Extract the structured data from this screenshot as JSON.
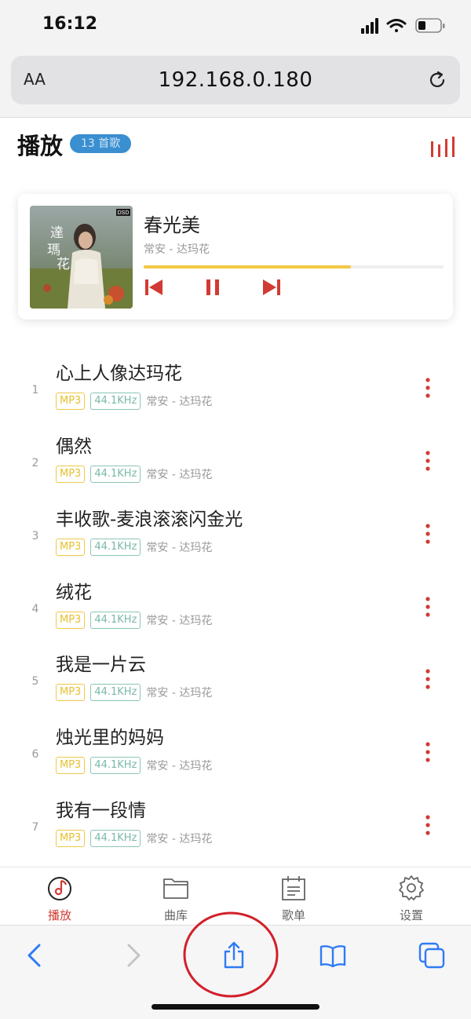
{
  "status_bar": {
    "time": "16:12"
  },
  "browser": {
    "text_size_label": "AA",
    "url": "192.168.0.180"
  },
  "header": {
    "title": "播放",
    "count_badge": "13 首歌"
  },
  "now_playing": {
    "title": "春光美",
    "artist": "常安 - 达玛花",
    "progress": 0.69,
    "cover_badge": "DSD"
  },
  "songs": [
    {
      "index": "1",
      "title": "心上人像达玛花",
      "format": "MP3",
      "sample_rate": "44.1KHz",
      "artist": "常安 - 达玛花"
    },
    {
      "index": "2",
      "title": "偶然",
      "format": "MP3",
      "sample_rate": "44.1KHz",
      "artist": "常安 - 达玛花"
    },
    {
      "index": "3",
      "title": "丰收歌-麦浪滚滚闪金光",
      "format": "MP3",
      "sample_rate": "44.1KHz",
      "artist": "常安 - 达玛花"
    },
    {
      "index": "4",
      "title": "绒花",
      "format": "MP3",
      "sample_rate": "44.1KHz",
      "artist": "常安 - 达玛花"
    },
    {
      "index": "5",
      "title": "我是一片云",
      "format": "MP3",
      "sample_rate": "44.1KHz",
      "artist": "常安 - 达玛花"
    },
    {
      "index": "6",
      "title": "烛光里的妈妈",
      "format": "MP3",
      "sample_rate": "44.1KHz",
      "artist": "常安 - 达玛花"
    },
    {
      "index": "7",
      "title": "我有一段情",
      "format": "MP3",
      "sample_rate": "44.1KHz",
      "artist": "常安 - 达玛花"
    }
  ],
  "app_nav": {
    "items": [
      {
        "label": "播放",
        "icon": "music-note-icon",
        "active": true
      },
      {
        "label": "曲库",
        "icon": "folder-icon",
        "active": false
      },
      {
        "label": "歌单",
        "icon": "playlist-icon",
        "active": false
      },
      {
        "label": "设置",
        "icon": "gear-icon",
        "active": false
      }
    ]
  },
  "toolbar": {
    "icons": [
      "back-icon",
      "forward-icon",
      "share-icon",
      "bookmarks-icon",
      "tabs-icon"
    ]
  },
  "colors": {
    "accent": "#d23b33",
    "badge": "#3a8fd0",
    "progress": "#f2c744",
    "format_tag": "#ecc94a",
    "rate_tag": "#8cc6b6",
    "ios_blue": "#2f7bf5"
  }
}
